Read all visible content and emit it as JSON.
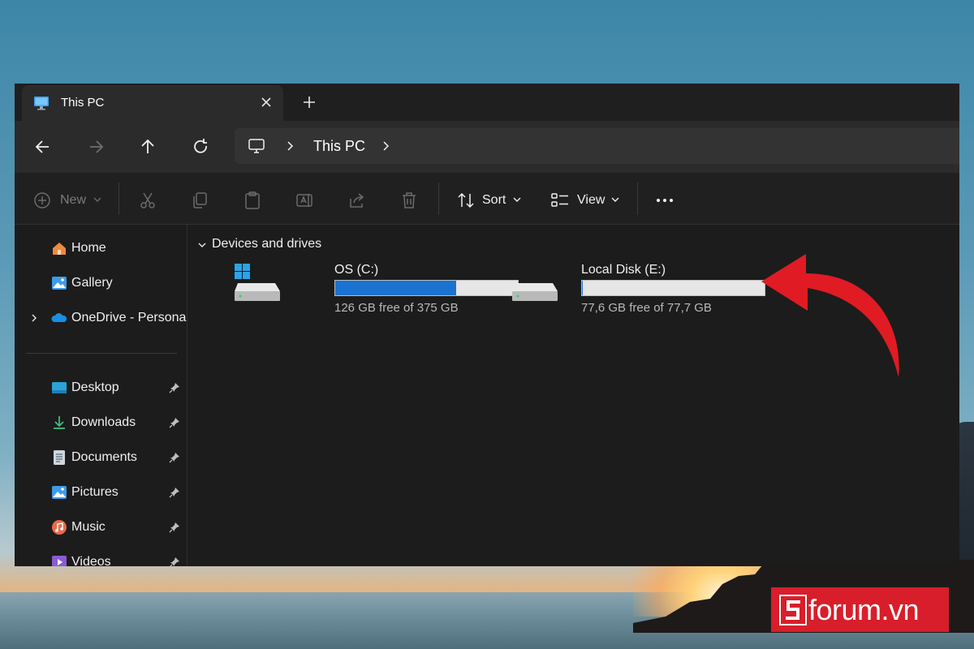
{
  "window": {
    "tab": {
      "title": "This PC",
      "icon": "monitor-icon"
    },
    "address": {
      "segments": [
        "This PC"
      ],
      "icon": "monitor-icon"
    }
  },
  "toolbar": {
    "new_label": "New",
    "sort_label": "Sort",
    "view_label": "View"
  },
  "sidebar": {
    "items": [
      {
        "label": "Home",
        "icon": "home-icon"
      },
      {
        "label": "Gallery",
        "icon": "gallery-icon"
      },
      {
        "label": "OneDrive - Persona",
        "icon": "onedrive-cloud-icon"
      }
    ],
    "pinned": [
      {
        "label": "Desktop",
        "icon": "desktop-folder-icon"
      },
      {
        "label": "Downloads",
        "icon": "downloads-icon"
      },
      {
        "label": "Documents",
        "icon": "documents-icon"
      },
      {
        "label": "Pictures",
        "icon": "pictures-icon"
      },
      {
        "label": "Music",
        "icon": "music-icon"
      },
      {
        "label": "Videos",
        "icon": "videos-icon"
      }
    ]
  },
  "content": {
    "group_label": "Devices and drives",
    "drives": [
      {
        "name": "OS (C:)",
        "free_text": "126 GB free of 375 GB",
        "used_fraction": 0.664
      },
      {
        "name": "Local Disk (E:)",
        "free_text": "77,6 GB free of 77,7 GB",
        "used_fraction": 0.001
      }
    ]
  },
  "watermark": {
    "brand": "forum.vn",
    "brand_initial": "S"
  },
  "colors": {
    "accent": "#1a73d1",
    "arrow": "#e01b24",
    "logo_bg": "#d81e2a"
  }
}
